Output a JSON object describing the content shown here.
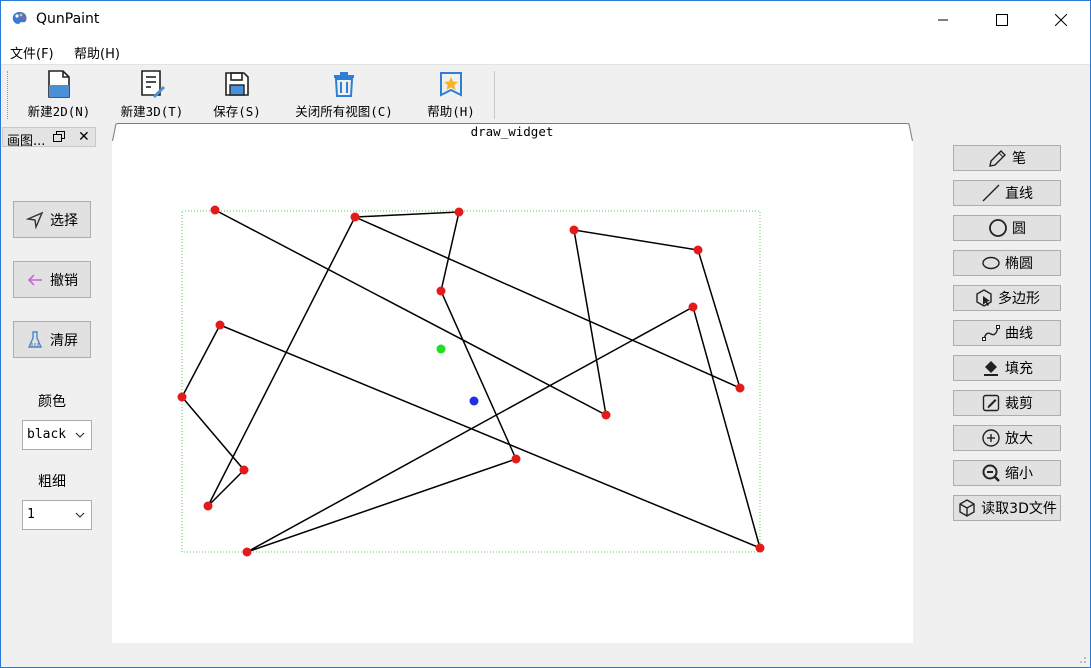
{
  "window": {
    "title": "QunPaint"
  },
  "menu": {
    "items": [
      {
        "label": "文件(F)"
      },
      {
        "label": "帮助(H)"
      }
    ]
  },
  "toolbar": {
    "buttons": [
      {
        "label": "新建2D(N)",
        "icon": "new-2d-document-icon"
      },
      {
        "label": "新建3D(T)",
        "icon": "new-3d-document-icon"
      },
      {
        "label": "保存(S)",
        "icon": "save-disk-icon"
      },
      {
        "label": "关闭所有视图(C)",
        "icon": "trash-icon"
      },
      {
        "label": "帮助(H)",
        "icon": "help-star-icon"
      }
    ]
  },
  "dock": {
    "title": "画图...",
    "buttons": [
      {
        "label": "选择",
        "icon": "select-arrow-icon"
      },
      {
        "label": "撤销",
        "icon": "undo-arrow-icon"
      },
      {
        "label": "清屏",
        "icon": "clear-brush-icon"
      }
    ],
    "color_label": "颜色",
    "color_value": "black",
    "width_label": "粗细",
    "width_value": "1"
  },
  "tab": {
    "label": "draw_widget"
  },
  "tools": {
    "items": [
      {
        "label": "笔",
        "icon": "pencil-icon"
      },
      {
        "label": "直线",
        "icon": "line-icon"
      },
      {
        "label": "圆",
        "icon": "circle-icon"
      },
      {
        "label": "椭圆",
        "icon": "ellipse-icon"
      },
      {
        "label": "多边形",
        "icon": "polygon-icon"
      },
      {
        "label": "曲线",
        "icon": "curve-icon"
      },
      {
        "label": "填充",
        "icon": "fill-bucket-icon"
      },
      {
        "label": "裁剪",
        "icon": "crop-edit-icon"
      },
      {
        "label": "放大",
        "icon": "zoom-in-icon"
      },
      {
        "label": "缩小",
        "icon": "zoom-out-icon"
      },
      {
        "label": "读取3D文件",
        "icon": "cube-icon"
      }
    ]
  },
  "colors": {
    "point": "#e31b1b",
    "line": "#000000",
    "selection_box": "#5cc85c",
    "center_green": "#1fe01f",
    "center_blue": "#1f2fe6"
  }
}
